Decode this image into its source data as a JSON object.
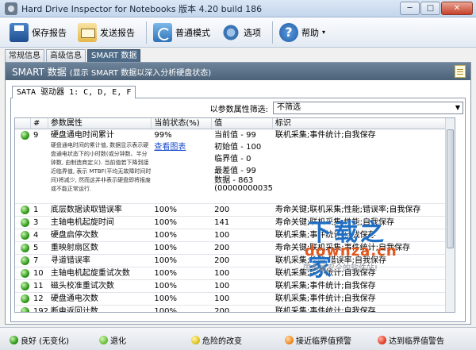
{
  "window": {
    "title": "Hard Drive Inspector for Notebooks 版本 4.20 build 186",
    "minimize": "─",
    "maximize": "□",
    "close": "✕"
  },
  "toolbar": {
    "save_report": "保存报告",
    "send_report": "发送报告",
    "normal_mode": "普通模式",
    "options": "选项",
    "help": "帮助",
    "dropdown_glyph": "▾"
  },
  "tabs": [
    "常规信息",
    "高级信息",
    "SMART 数据"
  ],
  "panel": {
    "title": "SMART 数据",
    "subtitle": "(显示 SMART 数据以深入分析硬盘状态)"
  },
  "drive_tab": "SATA 驱动器 1: C, D, E, F",
  "filter": {
    "label": "以参数属性筛选:",
    "value": "不筛选",
    "arrow": "▼"
  },
  "columns": {
    "num": "#",
    "attr": "参数属性",
    "state": "当前状态(%)",
    "val": "值",
    "idx": "标识"
  },
  "expanded_row": {
    "num": "9",
    "attr": "硬盘通电时间累计",
    "desc": "硬盘通电时间的累计值, 数据显示表示硬盘通电状态下的小时数(或分钟数、半分钟数, 由制造商定义). 当前值若下降到接近临界值, 表示 MTBF(平均无故障时间时间)将减少, 然而这并非表示硬盘即将报废或不能正常运行.",
    "state": "99%",
    "state_link": "查看图表",
    "current": "当前值 - 99",
    "initial": "初始值 - 100",
    "threshold": "临界值 - 0",
    "worst": "最差值 - 99",
    "data": "数据 - 863",
    "data_hex": "(00000000035Fh)",
    "idx": "联机采集;事件统计;自我保存"
  },
  "rows": [
    {
      "num": "1",
      "attr": "底层数据读取错误率",
      "state": "100%",
      "val": "200",
      "idx": "寿命关键;联机采集;性能;错误率;自我保存"
    },
    {
      "num": "3",
      "attr": "主轴电机起旋时间",
      "state": "100%",
      "val": "141",
      "idx": "寿命关键;联机采集;性能;自我保存"
    },
    {
      "num": "4",
      "attr": "硬盘启停次数",
      "state": "100%",
      "val": "100",
      "idx": "联机采集;事件统计;自我保存"
    },
    {
      "num": "5",
      "attr": "重映射扇区数",
      "state": "100%",
      "val": "200",
      "idx": "寿命关键;联机采集;事件统计;自我保存"
    },
    {
      "num": "7",
      "attr": "寻道错误率",
      "state": "100%",
      "val": "200",
      "idx": "联机采集;性能;错误率;自我保存"
    },
    {
      "num": "10",
      "attr": "主轴电机起旋重试次数",
      "state": "100%",
      "val": "100",
      "idx": "联机采集;事件统计;自我保存"
    },
    {
      "num": "11",
      "attr": "磁头校准重试次数",
      "state": "100%",
      "val": "100",
      "idx": "联机采集;事件统计;自我保存"
    },
    {
      "num": "12",
      "attr": "硬盘通电次数",
      "state": "100%",
      "val": "100",
      "idx": "联机采集;事件统计;自我保存"
    },
    {
      "num": "192",
      "attr": "断电返回计数",
      "state": "100%",
      "val": "200",
      "idx": "联机采集;事件统计;自我保存"
    },
    {
      "num": "193",
      "attr": "磁头加载/卸载计数",
      "state": "100%",
      "val": "200",
      "idx": "联机采集;事件统计;自我保存"
    }
  ],
  "legend": {
    "good": "良好 (无变化)",
    "degraded": "退化",
    "danger": "危险的改变",
    "near": "接近临界值预警",
    "reached": "达到临界值警告"
  },
  "watermark": {
    "big": "下载之家",
    "url": "downza.cn",
    "tag": "国内最安全的软件站!"
  },
  "colors": {
    "accent": "#4d6a86",
    "good": "#2f9a1a",
    "danger": "#e2c525",
    "near": "#f08e28",
    "reached": "#e2432a"
  }
}
